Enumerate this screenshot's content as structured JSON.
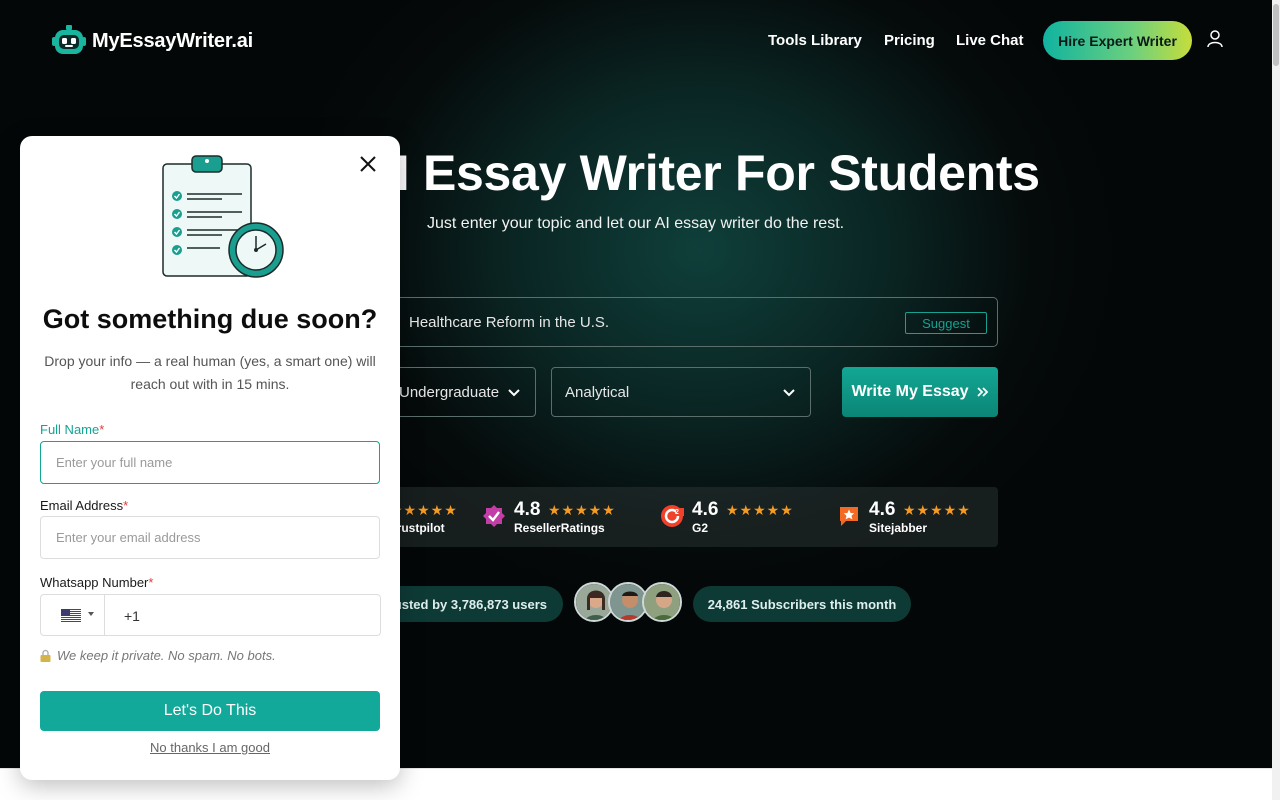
{
  "header": {
    "logo_text": "MyEssayWriter.ai",
    "nav": [
      {
        "label": "Tools Library"
      },
      {
        "label": "Pricing"
      },
      {
        "label": "Live Chat"
      }
    ],
    "cta_label": "Hire Expert Writer"
  },
  "hero": {
    "headline": "AI Essay Writer For Students",
    "subheadline": "Just enter your topic and let our AI essay writer do the rest.",
    "topic_value": "Healthcare Reform in the U.S.",
    "suggest_label": "Suggest",
    "level_value": "Undergraduate",
    "type_value": "Analytical",
    "write_label": "Write My Essay"
  },
  "ratings": [
    {
      "score": "",
      "stars": "★★★★★",
      "source": "Trustpilot"
    },
    {
      "score": "4.8",
      "stars": "★★★★★",
      "source": "ResellerRatings"
    },
    {
      "score": "4.6",
      "stars": "★★★★★",
      "source": "G2"
    },
    {
      "score": "4.6",
      "stars": "★★★★★",
      "source": "Sitejabber"
    }
  ],
  "stats": {
    "trusted": "Trusted by 3,786,873 users",
    "subscribers": "24,861 Subscribers this month"
  },
  "modal": {
    "title": "Got something due soon?",
    "description": "Drop your info — a real human (yes, a smart one) will reach out with in 15 mins.",
    "name_label": "Full Name",
    "name_placeholder": "Enter your full name",
    "email_label": "Email Address",
    "email_placeholder": "Enter your email address",
    "whatsapp_label": "Whatsapp Number",
    "phone_code": "+1",
    "privacy_note": "We keep it private. No spam. No bots.",
    "submit_label": "Let's Do This",
    "dismiss_label": "No thanks I am good"
  },
  "colors": {
    "accent": "#12a99a",
    "brand_gradient_start": "#10b3a0",
    "brand_gradient_end": "#c6dd3b",
    "star": "#f59a23",
    "required": "#e23b3b"
  },
  "icons": {
    "logo": "robot-face-icon",
    "user": "user-icon",
    "close": "close-icon",
    "chevron": "chevron-down-icon",
    "arrow": "double-chevron-right-icon",
    "lock": "lock-icon",
    "flag": "us-flag-icon"
  }
}
